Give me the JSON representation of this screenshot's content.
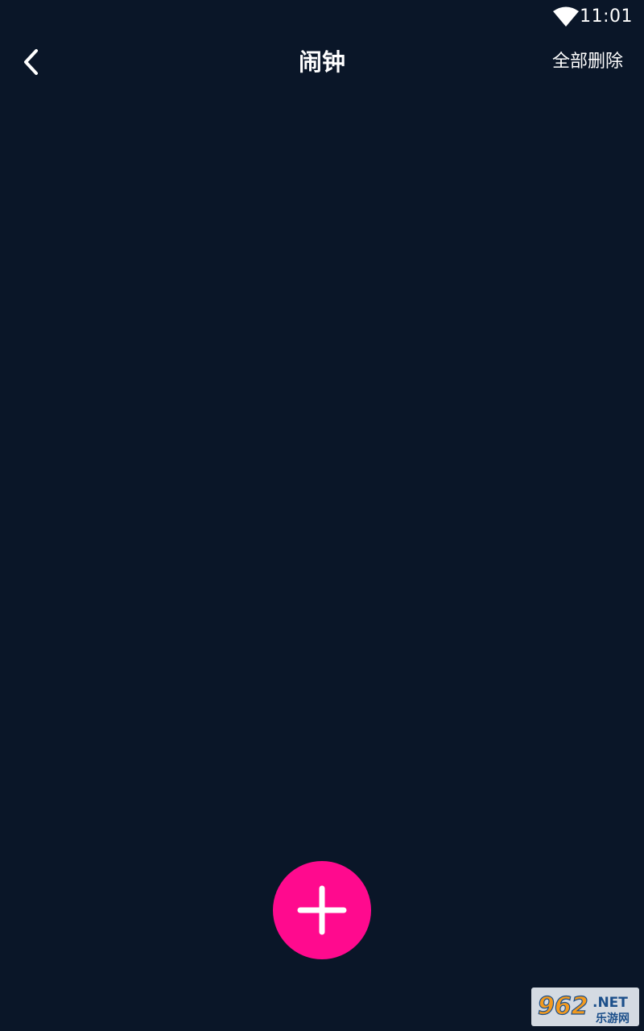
{
  "status_bar": {
    "time": "11:01",
    "wifi_icon": "wifi-icon"
  },
  "app_bar": {
    "back_icon": "chevron-left-icon",
    "title": "闹钟",
    "delete_all_label": "全部删除"
  },
  "fab": {
    "icon": "plus-icon"
  },
  "watermark": {
    "brand_number": "962",
    "brand_suffix": ".NET",
    "brand_name": "乐游网"
  },
  "colors": {
    "background": "#0a1628",
    "accent": "#ff0a8e",
    "text": "#ffffff"
  }
}
